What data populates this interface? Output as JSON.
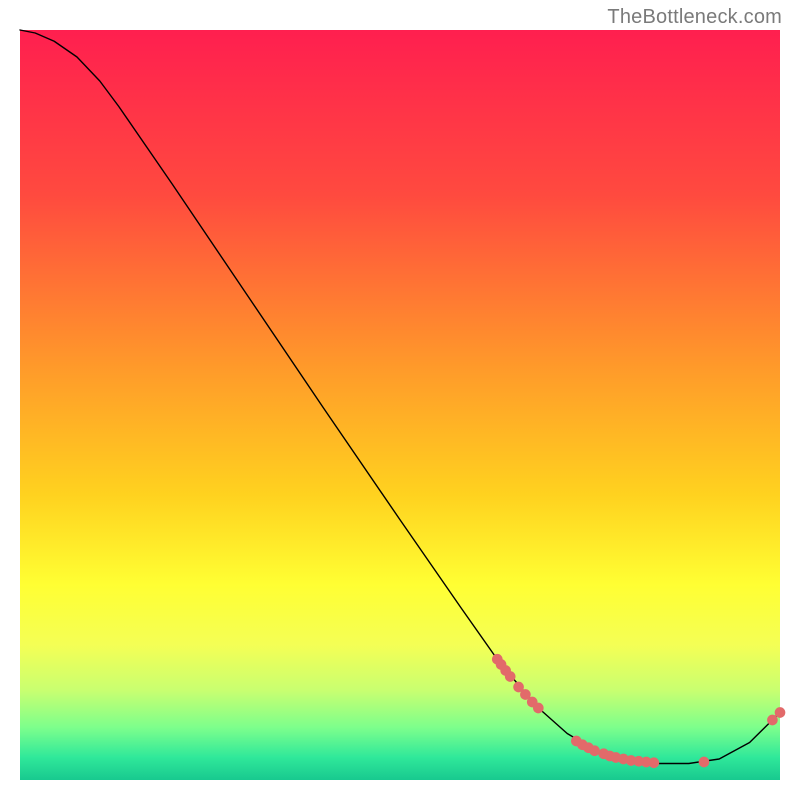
{
  "attribution": "TheBottleneck.com",
  "chart_data": {
    "type": "line",
    "title": "",
    "xlabel": "",
    "ylabel": "",
    "xlim": [
      0,
      100
    ],
    "ylim": [
      0,
      100
    ],
    "grid": false,
    "legend": false,
    "gradient_stops": [
      {
        "offset": 0.0,
        "color": "#ff1f4f"
      },
      {
        "offset": 0.22,
        "color": "#ff4a3f"
      },
      {
        "offset": 0.45,
        "color": "#ff9a2a"
      },
      {
        "offset": 0.62,
        "color": "#ffd21f"
      },
      {
        "offset": 0.74,
        "color": "#ffff33"
      },
      {
        "offset": 0.82,
        "color": "#f4ff55"
      },
      {
        "offset": 0.88,
        "color": "#c9ff70"
      },
      {
        "offset": 0.93,
        "color": "#7dff8c"
      },
      {
        "offset": 0.97,
        "color": "#2fe89a"
      },
      {
        "offset": 1.0,
        "color": "#18c98f"
      }
    ],
    "curve": [
      {
        "x": 0.0,
        "y": 100.0
      },
      {
        "x": 2.0,
        "y": 99.6
      },
      {
        "x": 4.5,
        "y": 98.5
      },
      {
        "x": 7.5,
        "y": 96.4
      },
      {
        "x": 10.5,
        "y": 93.2
      },
      {
        "x": 13.0,
        "y": 89.8
      },
      {
        "x": 20.0,
        "y": 79.5
      },
      {
        "x": 30.0,
        "y": 64.5
      },
      {
        "x": 40.0,
        "y": 49.5
      },
      {
        "x": 50.0,
        "y": 34.7
      },
      {
        "x": 58.0,
        "y": 23.0
      },
      {
        "x": 63.0,
        "y": 15.8
      },
      {
        "x": 68.0,
        "y": 9.8
      },
      {
        "x": 72.0,
        "y": 6.2
      },
      {
        "x": 76.0,
        "y": 3.8
      },
      {
        "x": 80.0,
        "y": 2.6
      },
      {
        "x": 84.0,
        "y": 2.2
      },
      {
        "x": 88.0,
        "y": 2.2
      },
      {
        "x": 92.0,
        "y": 2.8
      },
      {
        "x": 96.0,
        "y": 5.0
      },
      {
        "x": 100.0,
        "y": 9.0
      }
    ],
    "marker_clusters": [
      {
        "x": 62.8,
        "y": 16.1
      },
      {
        "x": 63.3,
        "y": 15.4
      },
      {
        "x": 63.9,
        "y": 14.6
      },
      {
        "x": 64.5,
        "y": 13.8
      },
      {
        "x": 65.6,
        "y": 12.4
      },
      {
        "x": 66.5,
        "y": 11.4
      },
      {
        "x": 67.4,
        "y": 10.4
      },
      {
        "x": 68.2,
        "y": 9.6
      },
      {
        "x": 73.2,
        "y": 5.2
      },
      {
        "x": 74.0,
        "y": 4.7
      },
      {
        "x": 74.8,
        "y": 4.3
      },
      {
        "x": 75.6,
        "y": 3.9
      },
      {
        "x": 76.8,
        "y": 3.5
      },
      {
        "x": 77.6,
        "y": 3.2
      },
      {
        "x": 78.4,
        "y": 3.0
      },
      {
        "x": 79.4,
        "y": 2.8
      },
      {
        "x": 80.4,
        "y": 2.6
      },
      {
        "x": 81.4,
        "y": 2.5
      },
      {
        "x": 82.4,
        "y": 2.4
      },
      {
        "x": 83.4,
        "y": 2.3
      },
      {
        "x": 90.0,
        "y": 2.4
      },
      {
        "x": 99.0,
        "y": 8.0
      },
      {
        "x": 100.0,
        "y": 9.0
      }
    ],
    "marker_color": "#e26a6a",
    "marker_radius_data": 0.7
  }
}
